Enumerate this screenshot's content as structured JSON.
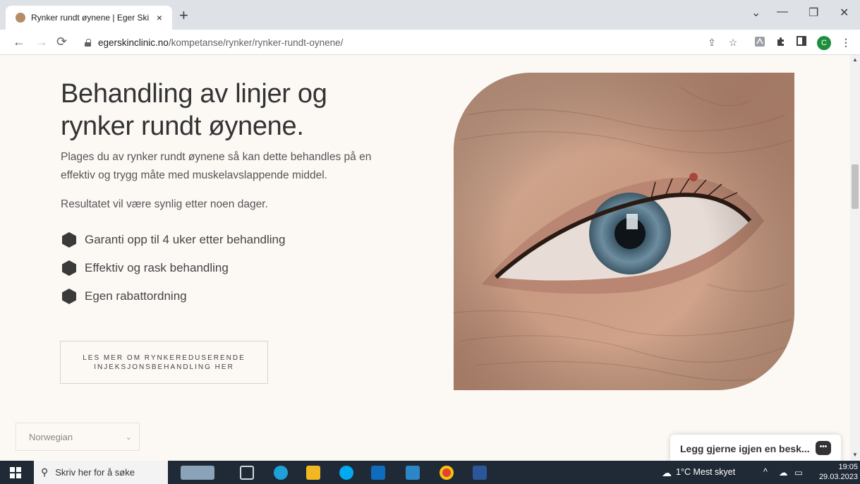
{
  "browser": {
    "tab_title": "Rynker rundt øynene | Eger Skin",
    "tab_close": "×",
    "new_tab": "+",
    "url_domain": "egerskinclinic.no",
    "url_path": "/kompetanse/rynker/rynker-rundt-oynene/",
    "profile_initial": "C",
    "window_controls": [
      "⌄",
      "—",
      "❐",
      "✕"
    ]
  },
  "page": {
    "heading": "Behandling av linjer og rynker rundt øynene.",
    "intro": "Plages du av rynker rundt øynene så kan dette behandles på en effektiv og trygg måte med muskelavslappende middel.",
    "result": "Resultatet vil være synlig etter noen dager.",
    "bullets": [
      "Garanti opp til 4 uker etter behandling",
      "Effektiv og rask behandling",
      "Egen rabattordning"
    ],
    "cta": "LES MER OM RYNKEREDUSERENDE INJEKSJONSBEHANDLING HER",
    "language": "Norwegian",
    "chat_label": "Legg gjerne igjen en besk..."
  },
  "taskbar": {
    "search_placeholder": "Skriv her for å søke",
    "weather": "1°C  Mest skyet",
    "time": "19:05",
    "date": "29.03.2023"
  },
  "colors": {
    "page_bg": "#fcf9f5",
    "bullet_hex": "#3a3a3a",
    "taskbar_bg": "#1f2a36",
    "profile_green": "#1e8e3e"
  }
}
